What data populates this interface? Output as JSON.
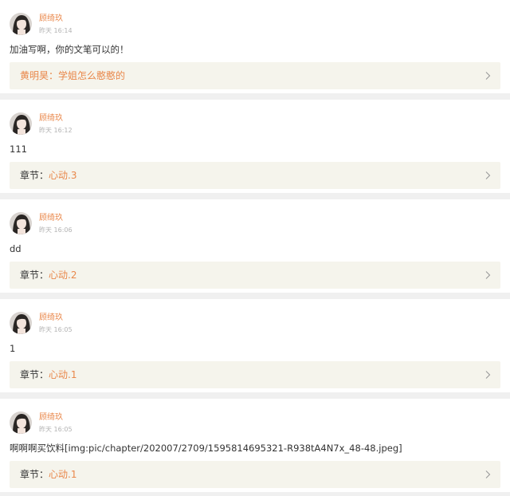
{
  "comments": [
    {
      "username": "顾绮玖",
      "time": "昨天 16:14",
      "content": "加油写啊，你的文笔可以的！",
      "link_type": "reply",
      "link_label": "",
      "link_value": "黄明昊：学姐怎么憨憨的"
    },
    {
      "username": "顾绮玖",
      "time": "昨天 16:12",
      "content": "111",
      "link_type": "chapter",
      "link_label": "章节：",
      "link_value": "心动.3"
    },
    {
      "username": "顾绮玖",
      "time": "昨天 16:06",
      "content": "dd",
      "link_type": "chapter",
      "link_label": "章节：",
      "link_value": "心动.2"
    },
    {
      "username": "顾绮玖",
      "time": "昨天 16:05",
      "content": "1",
      "link_type": "chapter",
      "link_label": "章节：",
      "link_value": "心动.1"
    },
    {
      "username": "顾绮玖",
      "time": "昨天 16:05",
      "content": "啊啊啊买饮料[img:pic/chapter/202007/2709/1595814695321-R938tA4N7x_48-48.jpeg]",
      "link_type": "chapter",
      "link_label": "章节：",
      "link_value": "心动.1"
    }
  ],
  "colors": {
    "accent": "#e9874a",
    "link_background": "#f5f4ec",
    "separator": "#f0f0f0"
  },
  "icons": {
    "avatar": "avatar-portrait",
    "chevron": "chevron-right-icon"
  }
}
